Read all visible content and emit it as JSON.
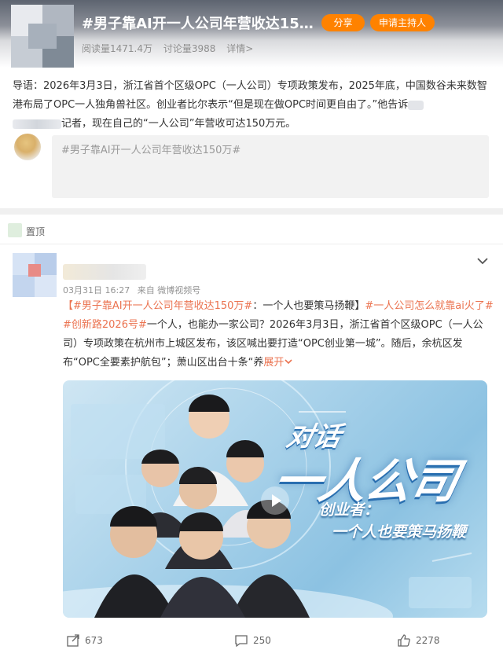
{
  "topic": {
    "title": "#男子靠AI开一人公司年营收达150...",
    "share_label": "分享",
    "host_label": "申请主持人",
    "reads": "阅读量1471.4万",
    "discussions": "讨论量3988",
    "details": "详情>"
  },
  "intro": {
    "part1": "导语：2026年3月3日，浙江省首个区级OPC（一人公司）专项政策发布，2025年底，中国数谷未来数智港布局了OPC一人独角兽社区。创业者比尔表示“但是现在做OPC时间更自由了。”他告诉",
    "part2": "记者，现在自己的“一人公司”年营收可达150万元。"
  },
  "composer": {
    "placeholder": "#男子靠AI开一人公司年营收达150万#"
  },
  "pinned": {
    "label": "置顶"
  },
  "post": {
    "time": "03月31日 16:27",
    "source": "来自 微博视频号",
    "tag1": "【#男子靠AI开一人公司年营收达150万#",
    "text1": "：一个人也要策马扬鞭】",
    "tag2": "#一人公司怎么就靠ai火了#",
    "text2": " ",
    "tag3": "#创新路2026号#",
    "text3": "一个人，也能办一家公司？2026年3月3日，浙江省首个区级OPC（一人公司）专项政策在杭州市上城区发布，该区喊出要打造“OPC创业第一城”。随后，余杭区发布“OPC全要素护航包”；萧山区出台十条“养",
    "expand": "展开"
  },
  "video": {
    "title_line1": "对话",
    "title_line2": "一人公司",
    "subtitle1": "创业者：",
    "subtitle2": "一个人也要策马扬鞭"
  },
  "actions": {
    "reposts": "673",
    "comments": "250",
    "likes": "2278"
  }
}
